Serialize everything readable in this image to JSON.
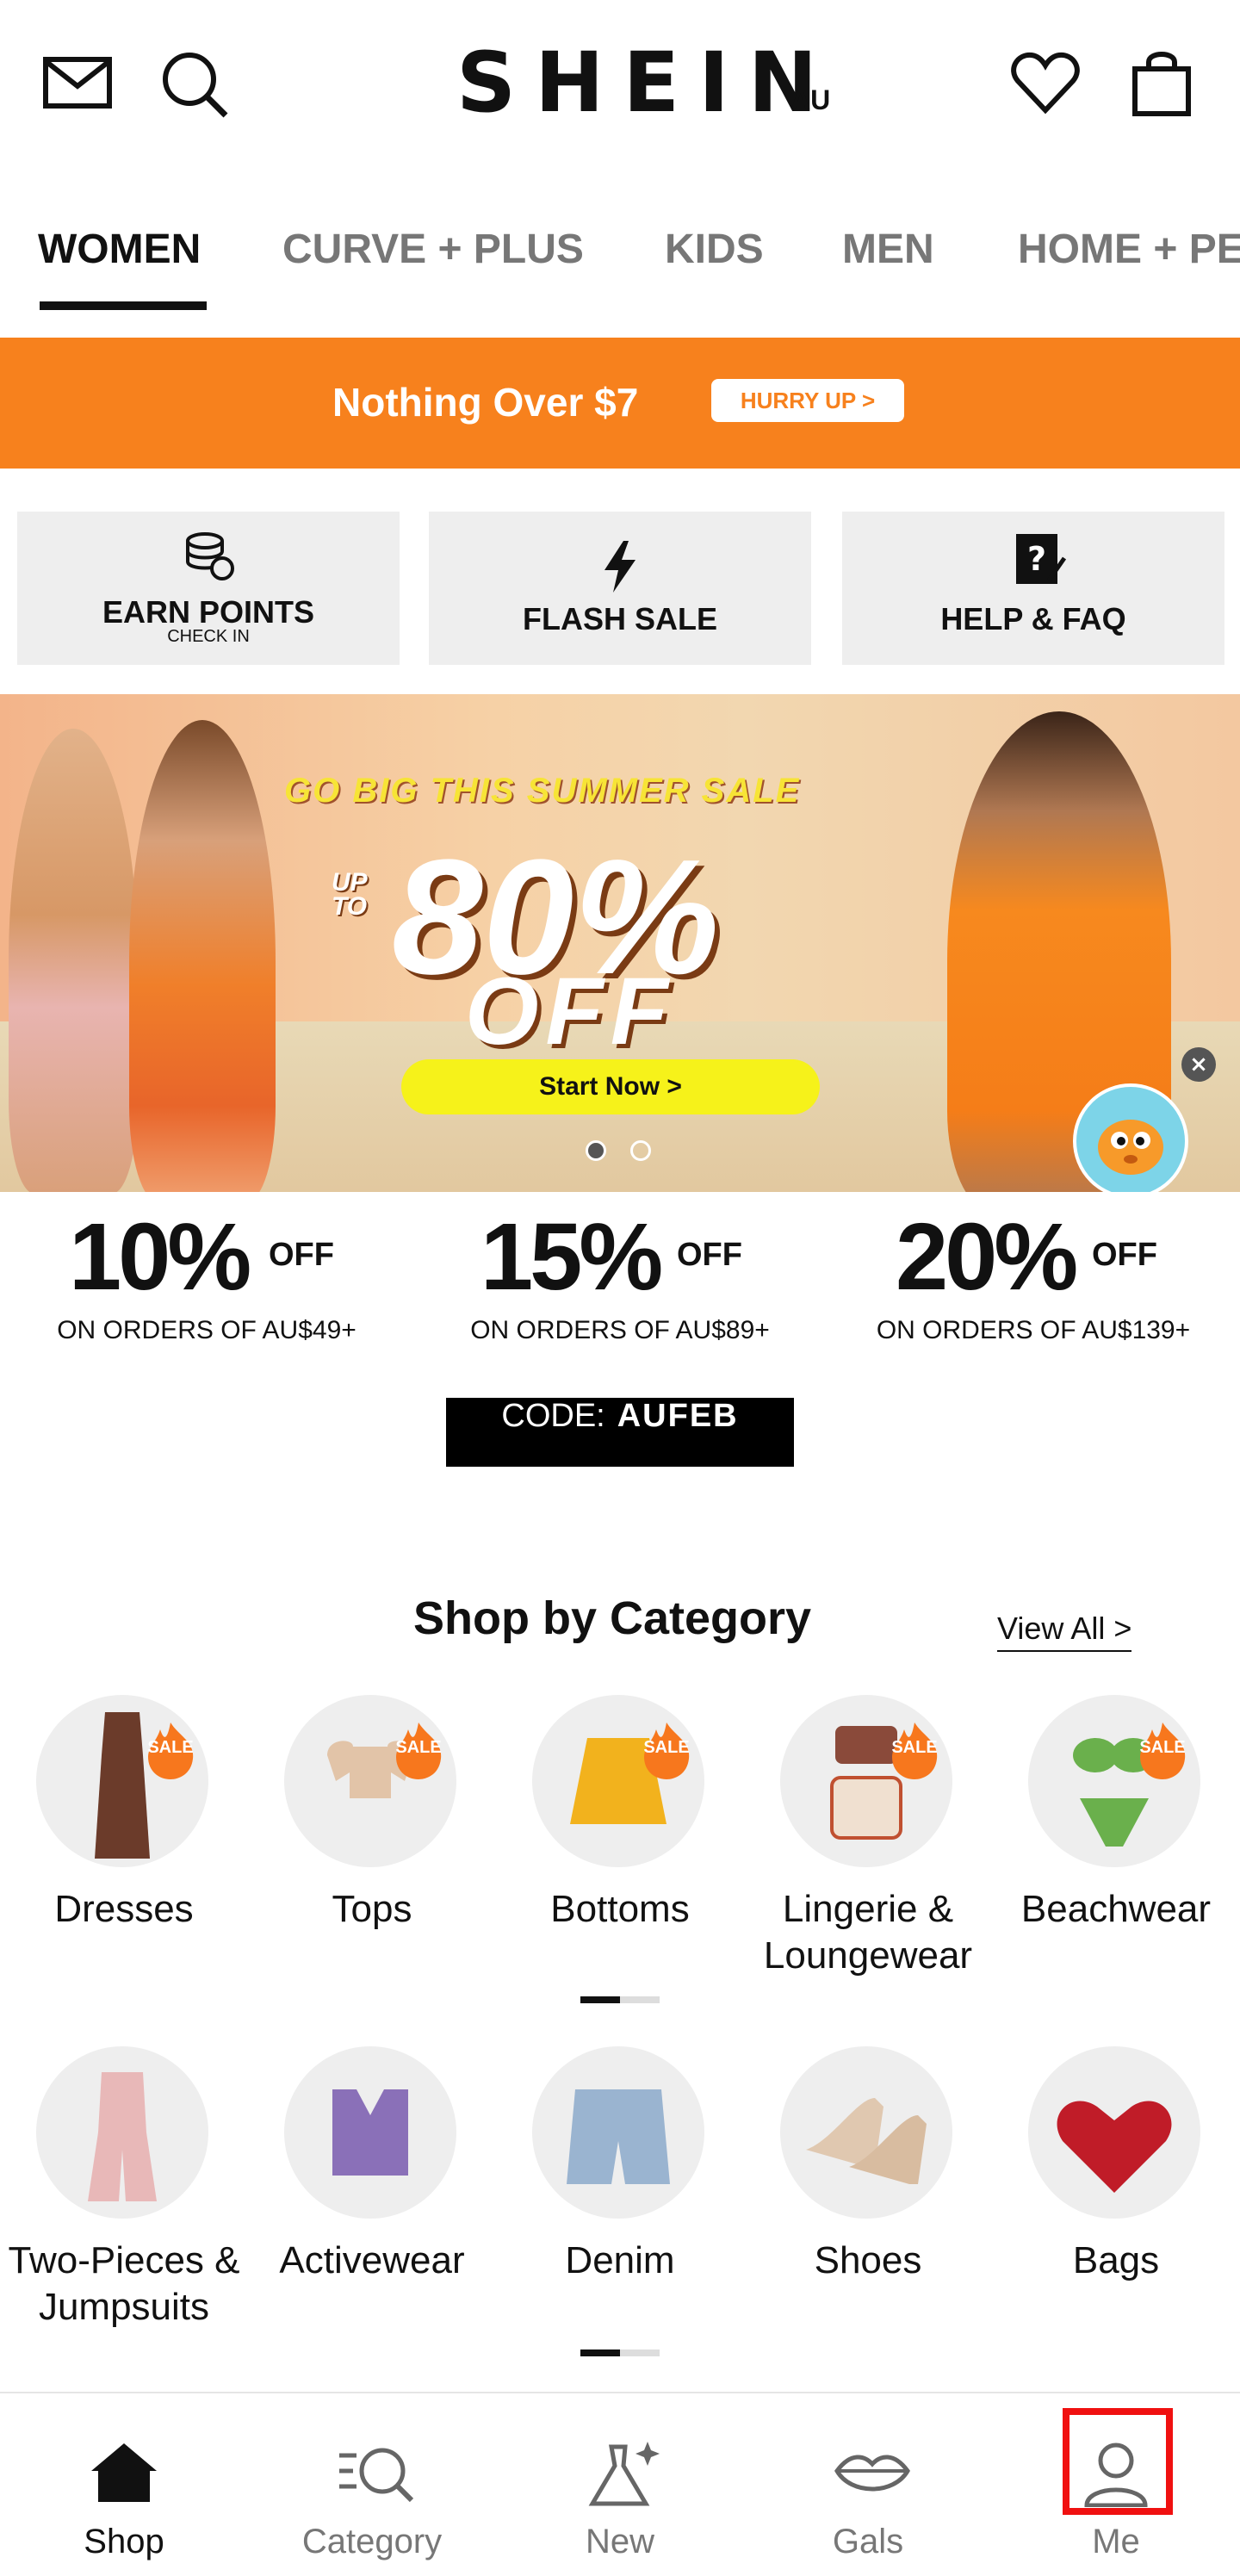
{
  "header": {
    "logo": "SHEIN",
    "region": "AU",
    "icons": [
      "mail-icon",
      "search-icon",
      "heart-icon",
      "bag-icon"
    ]
  },
  "tabs": [
    {
      "label": "WOMEN",
      "active": true
    },
    {
      "label": "CURVE + PLUS",
      "active": false
    },
    {
      "label": "KIDS",
      "active": false
    },
    {
      "label": "MEN",
      "active": false
    },
    {
      "label": "HOME + PE",
      "active": false
    }
  ],
  "promo": {
    "text": "Nothing Over $7",
    "cta": "HURRY UP >",
    "color": "#f7811d"
  },
  "quick_actions": [
    {
      "label": "EARN POINTS",
      "sub": "CHECK IN",
      "icon": "coins-icon"
    },
    {
      "label": "FLASH SALE",
      "sub": "",
      "icon": "lightning-icon"
    },
    {
      "label": "HELP & FAQ",
      "sub": "",
      "icon": "help-icon"
    }
  ],
  "hero": {
    "kicker": "GO BIG THIS SUMMER SALE",
    "upto_line1": "UP",
    "upto_line2": "TO",
    "big": "80%",
    "off": "OFF",
    "cta": "Start Now >",
    "slides": 2,
    "active_slide": 1
  },
  "discounts": [
    {
      "pct": "10%",
      "off": "OFF",
      "sub": "ON ORDERS OF AU$49+"
    },
    {
      "pct": "15%",
      "off": "OFF",
      "sub": "ON ORDERS OF AU$89+"
    },
    {
      "pct": "20%",
      "off": "OFF",
      "sub": "ON ORDERS OF AU$139+"
    }
  ],
  "code": {
    "label": "CODE:",
    "value": "AUFEB"
  },
  "shop_by_category": {
    "title": "Shop by Category",
    "view_all": "View All >",
    "row1": [
      {
        "label": "Dresses",
        "sale": "SALE"
      },
      {
        "label": "Tops",
        "sale": "SALE"
      },
      {
        "label": "Bottoms",
        "sale": "SALE"
      },
      {
        "label": "Lingerie & Loungewear",
        "sale": "SALE"
      },
      {
        "label": "Beachwear",
        "sale": "SALE"
      }
    ],
    "row2": [
      {
        "label": "Two-Pieces & Jumpsuits"
      },
      {
        "label": "Activewear"
      },
      {
        "label": "Denim"
      },
      {
        "label": "Shoes"
      },
      {
        "label": "Bags"
      }
    ]
  },
  "bottom_nav": [
    {
      "label": "Shop",
      "icon": "home-icon",
      "active": true
    },
    {
      "label": "Category",
      "icon": "category-search-icon",
      "active": false
    },
    {
      "label": "New",
      "icon": "dress-sparkle-icon",
      "active": false
    },
    {
      "label": "Gals",
      "icon": "lips-icon",
      "active": false
    },
    {
      "label": "Me",
      "icon": "user-icon",
      "active": false,
      "highlighted": true
    }
  ]
}
